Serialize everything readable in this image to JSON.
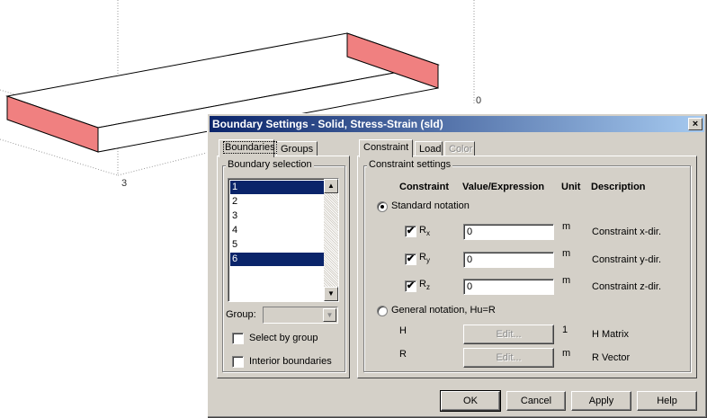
{
  "scene": {
    "axis_label_3": "3",
    "axis_label_0": "0",
    "highlight_color": "#f08080"
  },
  "dialog": {
    "title": "Boundary Settings - Solid, Stress-Strain (sld)",
    "close_label": "×",
    "left_tabs": [
      {
        "label": "Boundaries",
        "active": true
      },
      {
        "label": "Groups",
        "active": false
      }
    ],
    "boundary_selection": {
      "title": "Boundary selection",
      "items": [
        {
          "label": "1",
          "selected": true
        },
        {
          "label": "2",
          "selected": false
        },
        {
          "label": "3",
          "selected": false
        },
        {
          "label": "4",
          "selected": false
        },
        {
          "label": "5",
          "selected": false
        },
        {
          "label": "6",
          "selected": true
        }
      ],
      "group_label": "Group:",
      "group_value": "",
      "select_by_group_label": "Select by group",
      "interior_boundaries_label": "Interior boundaries"
    },
    "right_tabs": [
      {
        "label": "Constraint",
        "active": true
      },
      {
        "label": "Load",
        "active": false
      },
      {
        "label": "Color",
        "active": false,
        "disabled": true
      }
    ],
    "constraint_settings": {
      "title": "Constraint settings",
      "headers": {
        "constraint": "Constraint",
        "value": "Value/Expression",
        "unit": "Unit",
        "description": "Description"
      },
      "standard_notation_label": "Standard notation",
      "rows": [
        {
          "symbol": "R",
          "sub": "x",
          "checked": true,
          "value": "0",
          "unit": "m",
          "description": "Constraint x-dir."
        },
        {
          "symbol": "R",
          "sub": "y",
          "checked": true,
          "value": "0",
          "unit": "m",
          "description": "Constraint y-dir."
        },
        {
          "symbol": "R",
          "sub": "z",
          "checked": true,
          "value": "0",
          "unit": "m",
          "description": "Constraint z-dir."
        }
      ],
      "general_notation_label": "General notation, Hu=R",
      "h_label": "H",
      "h_button": "Edit...",
      "h_unit": "1",
      "h_description": "H Matrix",
      "r_label": "R",
      "r_button": "Edit...",
      "r_unit": "m",
      "r_description": "R Vector"
    },
    "buttons": {
      "ok": "OK",
      "cancel": "Cancel",
      "apply": "Apply",
      "help": "Help"
    }
  }
}
